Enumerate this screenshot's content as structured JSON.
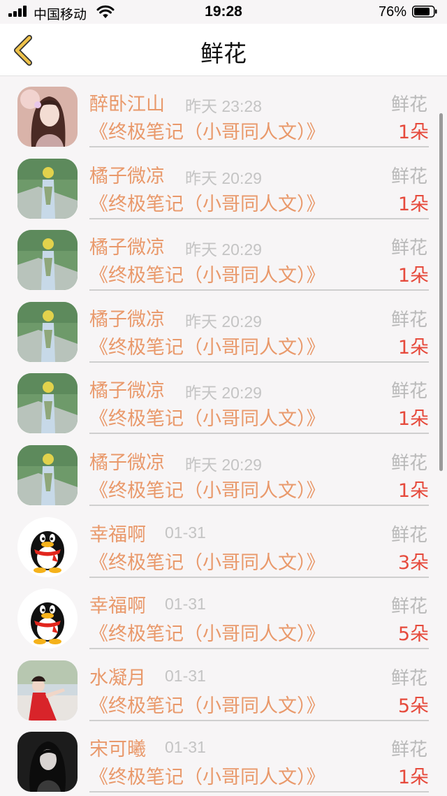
{
  "status_bar": {
    "carrier": "中国移动",
    "time": "19:28",
    "battery": "76%"
  },
  "nav": {
    "title": "鲜花",
    "back_icon": "chevron-left-icon"
  },
  "list": [
    {
      "name": "醉卧江山",
      "time": "昨天 23:28",
      "gift": "鲜花",
      "book": "《终极笔记（小哥同人文）》",
      "count": "1朵",
      "avatar": "anime-girl"
    },
    {
      "name": "橘子微凉",
      "time": "昨天 20:29",
      "gift": "鲜花",
      "book": "《终极笔记（小哥同人文）》",
      "count": "1朵",
      "avatar": "photo-bouquet"
    },
    {
      "name": "橘子微凉",
      "time": "昨天 20:29",
      "gift": "鲜花",
      "book": "《终极笔记（小哥同人文）》",
      "count": "1朵",
      "avatar": "photo-bouquet"
    },
    {
      "name": "橘子微凉",
      "time": "昨天 20:29",
      "gift": "鲜花",
      "book": "《终极笔记（小哥同人文）》",
      "count": "1朵",
      "avatar": "photo-bouquet"
    },
    {
      "name": "橘子微凉",
      "time": "昨天 20:29",
      "gift": "鲜花",
      "book": "《终极笔记（小哥同人文）》",
      "count": "1朵",
      "avatar": "photo-bouquet"
    },
    {
      "name": "橘子微凉",
      "time": "昨天 20:29",
      "gift": "鲜花",
      "book": "《终极笔记（小哥同人文）》",
      "count": "1朵",
      "avatar": "photo-bouquet"
    },
    {
      "name": "幸福啊",
      "time": "01-31",
      "gift": "鲜花",
      "book": "《终极笔记（小哥同人文）》",
      "count": "3朵",
      "avatar": "qq-penguin"
    },
    {
      "name": "幸福啊",
      "time": "01-31",
      "gift": "鲜花",
      "book": "《终极笔记（小哥同人文）》",
      "count": "5朵",
      "avatar": "qq-penguin"
    },
    {
      "name": "水凝月",
      "time": "01-31",
      "gift": "鲜花",
      "book": "《终极笔记（小哥同人文）》",
      "count": "5朵",
      "avatar": "photo-red-dress"
    },
    {
      "name": "宋可曦",
      "time": "01-31",
      "gift": "鲜花",
      "book": "《终极笔记（小哥同人文）》",
      "count": "1朵",
      "avatar": "photo-dark"
    }
  ],
  "colors": {
    "accent": "#e9996b",
    "count": "#e64a3c",
    "muted": "#c4c4c4",
    "back_chevron": "#e6b93c"
  }
}
